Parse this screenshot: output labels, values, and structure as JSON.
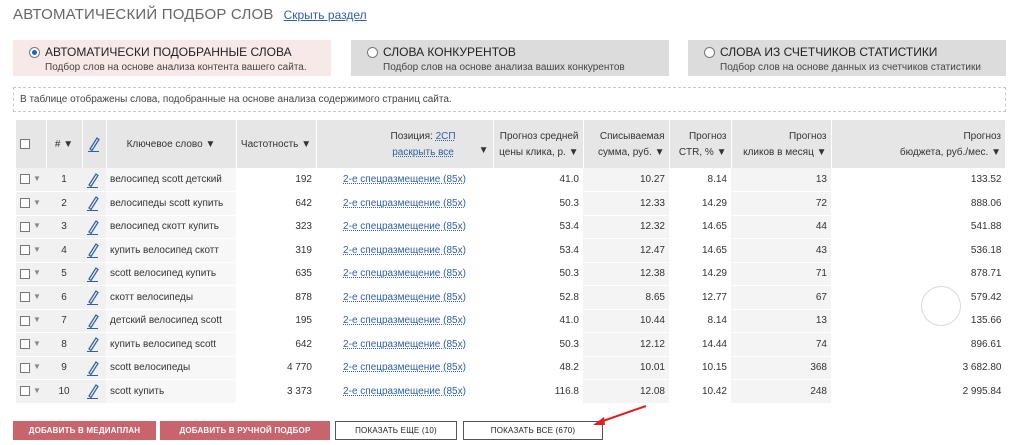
{
  "header": {
    "title": "АВТОМАТИЧЕСКИЙ ПОДБОР СЛОВ",
    "hide_link": "Скрыть раздел"
  },
  "options": [
    {
      "title": "АВТОМАТИЧЕСКИ ПОДОБРАННЫЕ СЛОВА",
      "subtitle": "Подбор слов на основе анализа контента вашего сайта.",
      "selected": true
    },
    {
      "title": "СЛОВА КОНКУРЕНТОВ",
      "subtitle": "Подбор слов на основе анализа ваших конкурентов",
      "selected": false
    },
    {
      "title": "СЛОВА ИЗ СЧЕТЧИКОВ СТАТИСТИКИ",
      "subtitle": "Подбор слов на основе данных из счетчиков статистики",
      "selected": false
    }
  ],
  "info_text": "В таблице отображены слова, подобранные на основе анализа содержимого страниц сайта.",
  "table": {
    "headers": {
      "num": "#",
      "keyword": "Ключевое слово",
      "frequency": "Частотность",
      "position_label": "Позиция:",
      "position_link": "2СП",
      "expand_all": "раскрыть все",
      "cpc_line1": "Прогноз средней",
      "cpc_line2": "цены клика, р.",
      "spend_line1": "Списываемая",
      "spend_line2": "сумма, руб.",
      "ctr_line1": "Прогноз",
      "ctr_line2": "CTR, %",
      "clicks_line1": "Прогноз",
      "clicks_line2": "кликов в месяц",
      "budget_line1": "Прогноз",
      "budget_line2": "бюджета, руб./мес."
    },
    "sort_arrow": "▼",
    "rows": [
      {
        "n": "1",
        "keyword": "велосипед scott детский",
        "freq": "192",
        "pos": "2-е спецразмещение (85х)",
        "cpc": "41.0",
        "spend": "10.27",
        "ctr": "8.14",
        "clicks": "13",
        "budget": "133.52"
      },
      {
        "n": "2",
        "keyword": "велосипеды scott купить",
        "freq": "642",
        "pos": "2-е спецразмещение (85х)",
        "cpc": "50.3",
        "spend": "12.33",
        "ctr": "14.29",
        "clicks": "72",
        "budget": "888.06"
      },
      {
        "n": "3",
        "keyword": "велосипед скотт купить",
        "freq": "323",
        "pos": "2-е спецразмещение (85х)",
        "cpc": "53.4",
        "spend": "12.32",
        "ctr": "14.65",
        "clicks": "44",
        "budget": "541.88"
      },
      {
        "n": "4",
        "keyword": "купить велосипед скотт",
        "freq": "319",
        "pos": "2-е спецразмещение (85х)",
        "cpc": "53.4",
        "spend": "12.47",
        "ctr": "14.65",
        "clicks": "43",
        "budget": "536.18"
      },
      {
        "n": "5",
        "keyword": "scott велосипед купить",
        "freq": "635",
        "pos": "2-е спецразмещение (85х)",
        "cpc": "50.3",
        "spend": "12.38",
        "ctr": "14.29",
        "clicks": "71",
        "budget": "878.71"
      },
      {
        "n": "6",
        "keyword": "скотт велосипеды",
        "freq": "878",
        "pos": "2-е спецразмещение (85х)",
        "cpc": "52.8",
        "spend": "8.65",
        "ctr": "12.77",
        "clicks": "67",
        "budget": "579.42"
      },
      {
        "n": "7",
        "keyword": "детский велосипед scott",
        "freq": "195",
        "pos": "2-е спецразмещение (85х)",
        "cpc": "41.0",
        "spend": "10.44",
        "ctr": "8.14",
        "clicks": "13",
        "budget": "135.66"
      },
      {
        "n": "8",
        "keyword": "купить велосипед scott",
        "freq": "642",
        "pos": "2-е спецразмещение (85х)",
        "cpc": "50.3",
        "spend": "12.12",
        "ctr": "14.44",
        "clicks": "74",
        "budget": "896.61"
      },
      {
        "n": "9",
        "keyword": "scott велосипеды",
        "freq": "4 770",
        "pos": "2-е спецразмещение (85х)",
        "cpc": "48.2",
        "spend": "10.01",
        "ctr": "10.15",
        "clicks": "368",
        "budget": "3 682.80"
      },
      {
        "n": "10",
        "keyword": "scott купить",
        "freq": "3 373",
        "pos": "2-е спецразмещение (85х)",
        "cpc": "116.8",
        "spend": "12.08",
        "ctr": "10.42",
        "clicks": "248",
        "budget": "2 995.84"
      }
    ]
  },
  "buttons": {
    "add_mediaplan": "ДОБАВИТЬ В МЕДИАПЛАН",
    "add_manual": "ДОБАВИТЬ В РУЧНОЙ ПОДБОР",
    "show_more": "ПОКАЗАТЬ ЕЩЕ (10)",
    "show_all": "ПОКАЗАТЬ ВСЕ (670)"
  },
  "colors": {
    "accent_red": "#c8646b",
    "link_blue": "#2f5fa9",
    "annotation_arrow": "#e02020"
  }
}
